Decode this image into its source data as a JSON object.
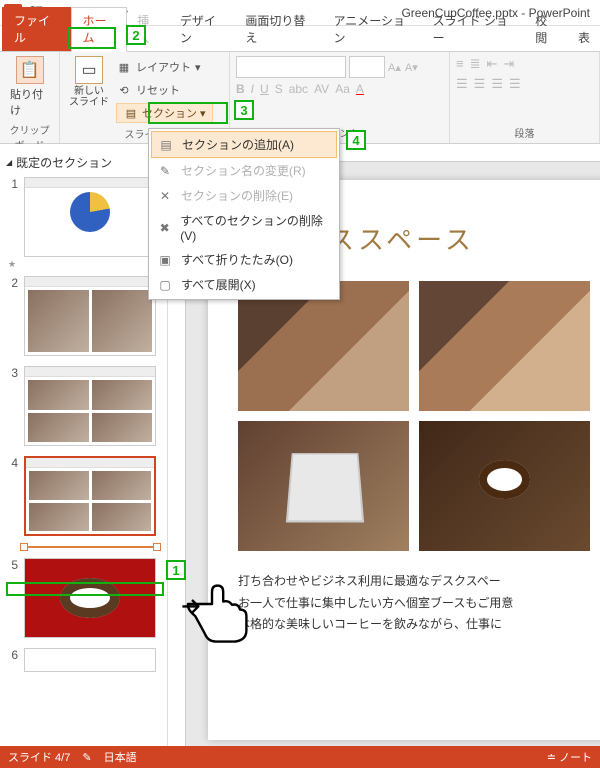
{
  "titlebar": {
    "filename": "GreenCupCoffee.pptx - PowerPoint"
  },
  "tabs": {
    "file": "ファイル",
    "home": "ホーム",
    "insert": "挿入",
    "design": "デザイン",
    "transitions": "画面切り替え",
    "animations": "アニメーション",
    "slideshow": "スライド ショー",
    "review": "校閲",
    "view": "表"
  },
  "ribbon": {
    "paste": "貼り付け",
    "clipboard": "クリップボード",
    "newslide": "新しい\nスライド",
    "layout": "レイアウト",
    "reset": "リセット",
    "section": "セクション",
    "slides_group": "スライド",
    "font_group": "フォント",
    "paragraph_group": "段落"
  },
  "dropdown": {
    "add_section": "セクションの追加(A)",
    "rename_section": "セクション名の変更(R)",
    "delete_section": "セクションの削除(E)",
    "delete_all": "すべてのセクションの削除(V)",
    "collapse_all": "すべて折りたたみ(O)",
    "expand_all": "すべて展開(X)"
  },
  "thumbs": {
    "default_section": "既定のセクション",
    "n1": "1",
    "n2": "2",
    "n3": "3",
    "n4": "4",
    "n5": "5",
    "n6": "6"
  },
  "slide": {
    "title": "ビジネススペース",
    "body1": "打ち合わせやビジネス利用に最適なデスクスペー",
    "body2": "お一人で仕事に集中したい方へ個室ブースもご用意",
    "body3": "本格的な美味しいコーヒーを飲みながら、仕事に"
  },
  "status": {
    "slide_counter": "スライド 4/7",
    "language": "日本語",
    "notes": "ノート"
  },
  "markers": {
    "m1": "1",
    "m2": "2",
    "m3": "3",
    "m4": "4"
  }
}
